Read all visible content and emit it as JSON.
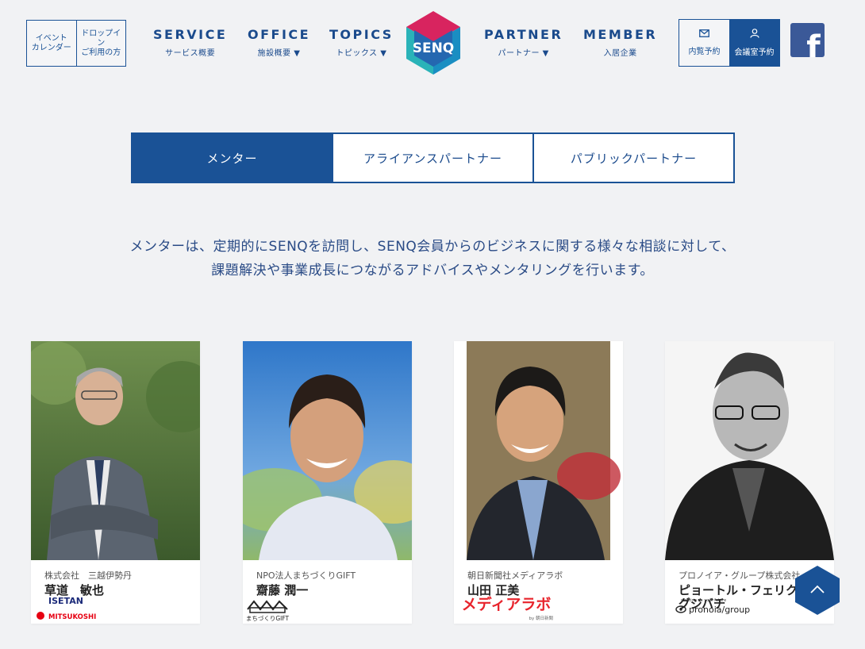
{
  "header": {
    "left_buttons": [
      {
        "label": "イベント\nカレンダー"
      },
      {
        "label": "ドロップイン\nご利用の方"
      }
    ],
    "nav": [
      {
        "main": "SERVICE",
        "sub": "サービス概要"
      },
      {
        "main": "OFFICE",
        "sub": "施設概要 ▼"
      },
      {
        "main": "TOPICS",
        "sub": "トピックス ▼"
      },
      {
        "main": "PARTNER",
        "sub": "パートナー ▼"
      },
      {
        "main": "MEMBER",
        "sub": "入居企業"
      }
    ],
    "logo_text": "SENQ",
    "right_buttons": [
      {
        "label": "内覧予約",
        "icon": "envelope-icon"
      },
      {
        "label": "会議室予約",
        "icon": "user-icon"
      }
    ],
    "facebook_letter": "f"
  },
  "tabs": [
    {
      "label": "メンター",
      "active": true
    },
    {
      "label": "アライアンスパートナー",
      "active": false
    },
    {
      "label": "パブリックパートナー",
      "active": false
    }
  ],
  "intro": {
    "line1": "メンターは、定期的にSENQを訪問し、SENQ会員からのビジネスに関する様々な相談に対して、",
    "line2": "課題解決や事業成長につながるアドバイスやメンタリングを行います。"
  },
  "mentors": [
    {
      "company": "株式会社　三越伊勢丹",
      "name": "草道　敏也",
      "badge": {
        "line1": "ISETAN",
        "line2": "MITSUKOSHI"
      }
    },
    {
      "company": "NPO法人まちづくりGIFT",
      "name": "齋藤 潤一",
      "badge": {
        "line1": "まちづくりGIFT"
      }
    },
    {
      "company": "朝日新聞社メディアラボ",
      "name": "山田 正美",
      "badge": {
        "line1": "メディアラボ",
        "line2": "by 朝日新聞"
      }
    },
    {
      "company": "プロノイア・グループ株式会社",
      "name": "ピョートル・フェリクス・グジバチ",
      "badge": {
        "line1": "working on your future",
        "line2": "pronoia/group"
      }
    }
  ],
  "colors": {
    "brand_blue": "#1a5296",
    "background": "#f1f2f4",
    "facebook": "#3b5998",
    "logo_pink": "#d8245f",
    "logo_teal": "#2ab3b8"
  }
}
